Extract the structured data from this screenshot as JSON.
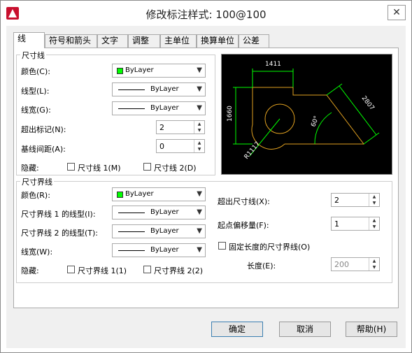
{
  "window": {
    "title": "修改标注样式: 100@100",
    "close_label": "✕"
  },
  "tabs": [
    {
      "label": "线"
    },
    {
      "label": "符号和箭头"
    },
    {
      "label": "文字"
    },
    {
      "label": "调整"
    },
    {
      "label": "主单位"
    },
    {
      "label": "换算单位"
    },
    {
      "label": "公差"
    }
  ],
  "dim_line": {
    "title": "尺寸线",
    "color_label": "颜色(C):",
    "color_value": "ByLayer",
    "linetype_label": "线型(L):",
    "linetype_value": "ByLayer",
    "lineweight_label": "线宽(G):",
    "lineweight_value": "ByLayer",
    "extend_label": "超出标记(N):",
    "extend_value": "2",
    "baseline_label": "基线间距(A):",
    "baseline_value": "0",
    "suppress_label": "隐藏:",
    "suppress_1": "尺寸线 1(M)",
    "suppress_2": "尺寸线 2(D)"
  },
  "ext_line": {
    "title": "尺寸界线",
    "color_label": "颜色(R):",
    "color_value": "ByLayer",
    "linetype1_label": "尺寸界线 1 的线型(I):",
    "linetype1_value": "ByLayer",
    "linetype2_label": "尺寸界线 2 的线型(T):",
    "linetype2_value": "ByLayer",
    "lineweight_label": "线宽(W):",
    "lineweight_value": "ByLayer",
    "suppress_label": "隐藏:",
    "suppress_1": "尺寸界线 1(1)",
    "suppress_2": "尺寸界线 2(2)",
    "beyond_label": "超出尺寸线(X):",
    "beyond_value": "2",
    "offset_label": "起点偏移量(F):",
    "offset_value": "1",
    "fixed_label": "固定长度的尺寸界线(O)",
    "length_label": "长度(E):",
    "length_value": "200"
  },
  "preview": {
    "dim_top": "1411",
    "dim_left": "1660",
    "dim_right": "2807",
    "dim_radius": "R1117",
    "dim_angle": "60°"
  },
  "buttons": {
    "ok": "确定",
    "cancel": "取消",
    "help": "帮助(H)"
  },
  "colors": {
    "swatch": "#00ff00",
    "preview_bg": "#000000",
    "dim_color": "#00ff00",
    "geom_color": "#e0a020"
  }
}
